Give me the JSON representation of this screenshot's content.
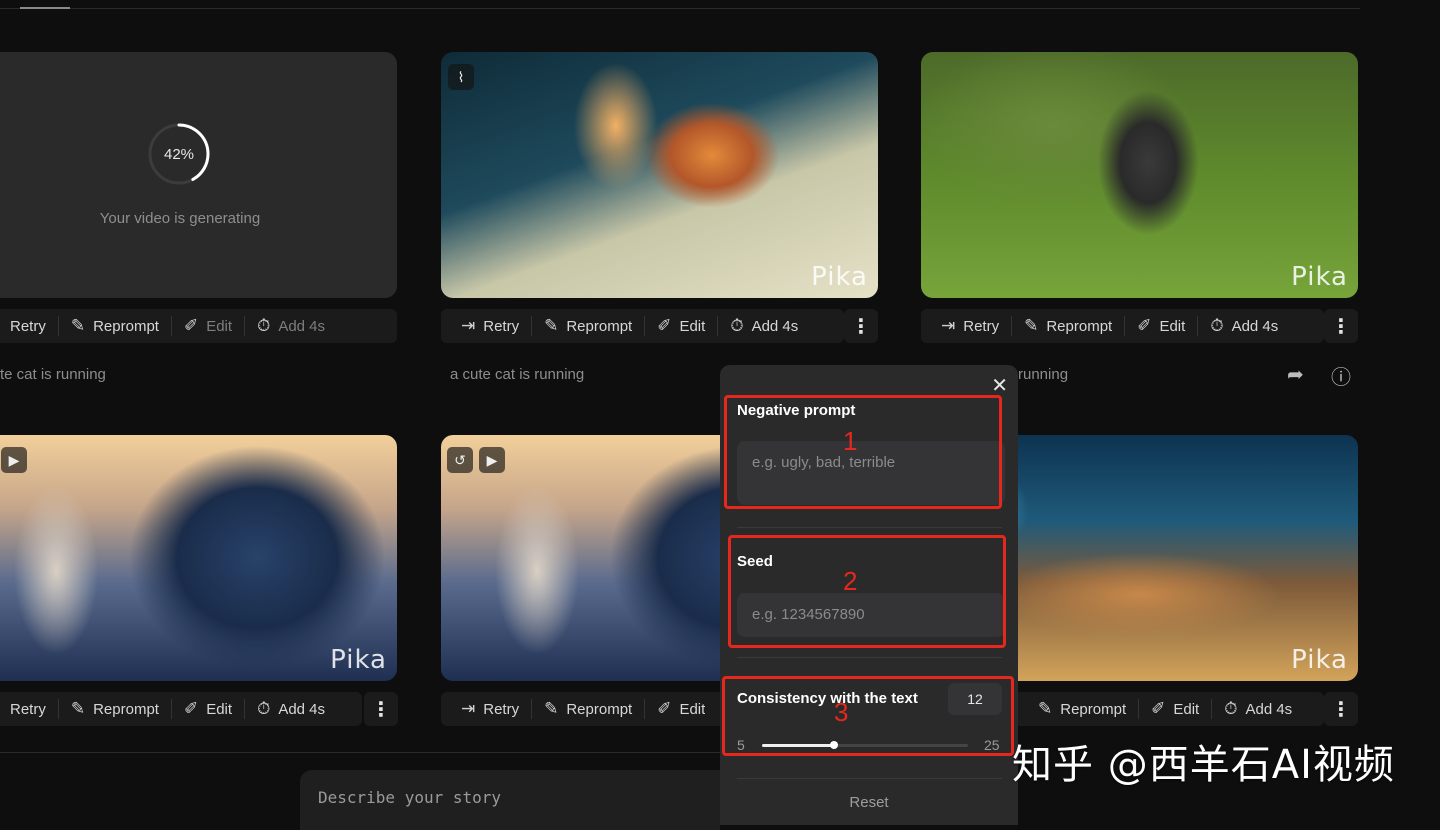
{
  "generating_card": {
    "progress_label": "42%",
    "progress": 0.42,
    "status": "Your video is generating"
  },
  "toolbar": {
    "retry": "Retry",
    "reprompt": "Reprompt",
    "edit": "Edit",
    "add": "Add 4s",
    "more": "⋮"
  },
  "captions": {
    "c1": "te cat is running",
    "c2": "a cute cat is running",
    "c3": "running"
  },
  "brand": "Pika",
  "story_input": {
    "placeholder": "Describe your story"
  },
  "panel": {
    "close": "✕",
    "negative_prompt": {
      "title": "Negative prompt",
      "placeholder": "e.g. ugly, bad, terrible"
    },
    "seed": {
      "title": "Seed",
      "placeholder": "e.g. 1234567890"
    },
    "consistency": {
      "title": "Consistency with the text",
      "value": "12",
      "min": "5",
      "max": "25",
      "fraction": 0.35
    },
    "reset": "Reset"
  },
  "annotations": {
    "n1": "1",
    "n2": "2",
    "n3": "3",
    "color": "#e5281d"
  },
  "watermark": "知乎 @西羊石AI视频"
}
